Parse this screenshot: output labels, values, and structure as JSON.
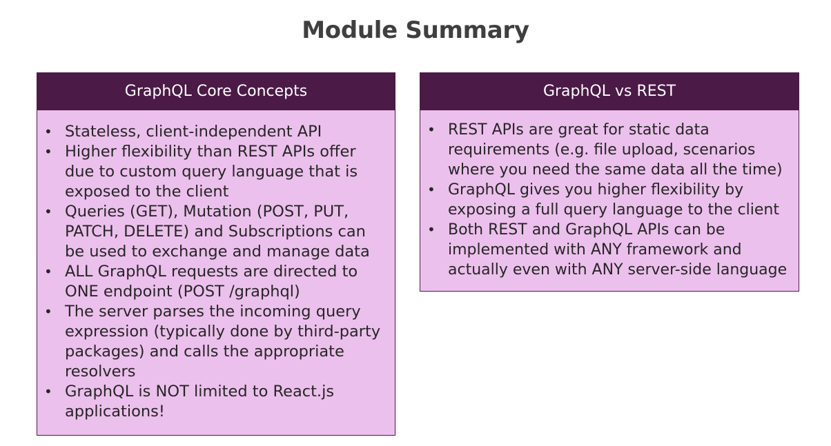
{
  "title": "Module Summary",
  "left_card": {
    "header": "GraphQL Core Concepts",
    "items": [
      "Stateless, client-independent API",
      "Higher flexibility than REST APIs offer due to custom query language that is exposed to the client",
      "Queries (GET), Mutation (POST, PUT, PATCH, DELETE) and Subscriptions can be used to exchange and manage data",
      "ALL GraphQL requests are directed to ONE endpoint (POST /graphql)",
      "The server parses the incoming query expression (typically done by third-party packages) and calls the appropriate resolvers",
      "GraphQL is NOT limited to React.js applications!"
    ]
  },
  "right_card": {
    "header": "GraphQL vs REST",
    "items": [
      "REST APIs are great for static data requirements (e.g. file upload, scenarios where you need the same data all the time)",
      "GraphQL gives you higher flexibility by exposing a full query language to the client",
      "Both REST and GraphQL APIs can be implemented with ANY framework and actually even with ANY server-side language"
    ]
  },
  "bullet_glyph": "•",
  "colors": {
    "header_bg": "#4b1a47",
    "card_bg": "#ecc0ec",
    "title_text": "#3f3f3f",
    "body_text": "#262626"
  }
}
